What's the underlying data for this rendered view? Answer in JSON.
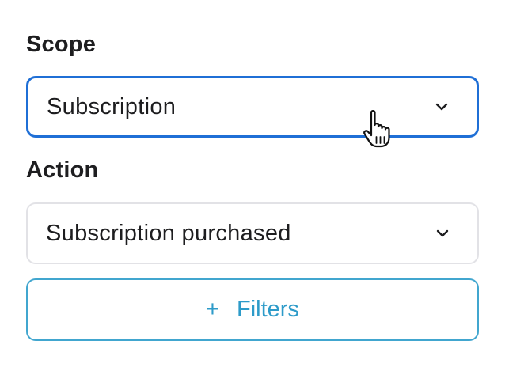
{
  "form": {
    "scope_label": "Scope",
    "scope_value": "Subscription",
    "action_label": "Action",
    "action_value": "Subscription purchased",
    "filters_button": {
      "icon": "+",
      "label": "Filters"
    }
  },
  "cursor": {
    "type": "pointer-hand-icon"
  },
  "colors": {
    "focus_border": "#1f6fd6",
    "default_border": "#e2e2e6",
    "filters_accent": "#2d9bc9"
  }
}
